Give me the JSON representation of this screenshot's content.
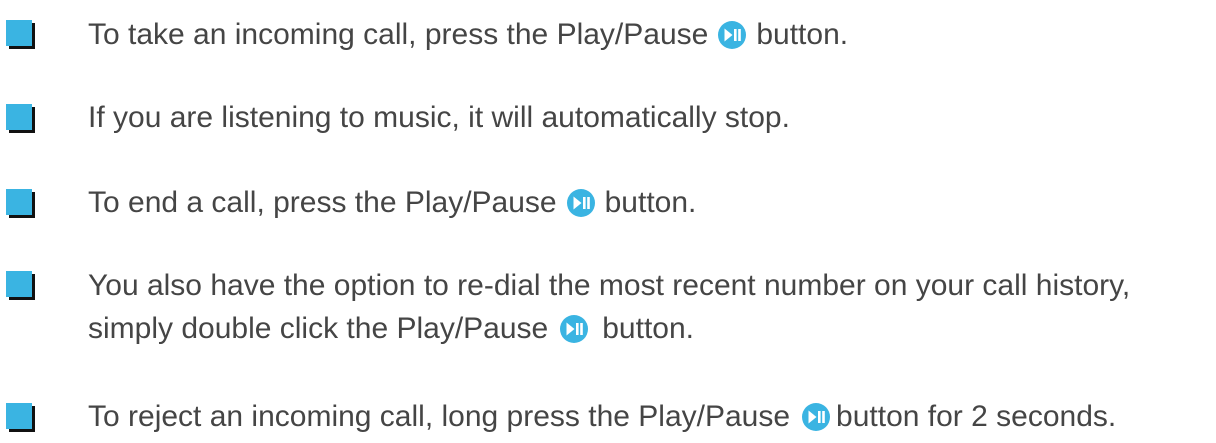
{
  "icon": {
    "name": "play-pause-icon",
    "color": "#3ab4e2"
  },
  "bullet_color": "#3ab4e2",
  "items": [
    {
      "before": "To take an incoming call, press the Play/Pause",
      "after": "button."
    },
    {
      "text": "If you are listening to music, it will automatically stop."
    },
    {
      "before": "To end a call, press the Play/Pause",
      "after": "button."
    },
    {
      "line1": "You also have the option to re-dial the most recent number on your call history,",
      "before": "simply double click the Play/Pause",
      "after": "button."
    },
    {
      "before": "To reject an incoming call, long press the Play/Pause",
      "after": "button for 2 seconds."
    }
  ]
}
